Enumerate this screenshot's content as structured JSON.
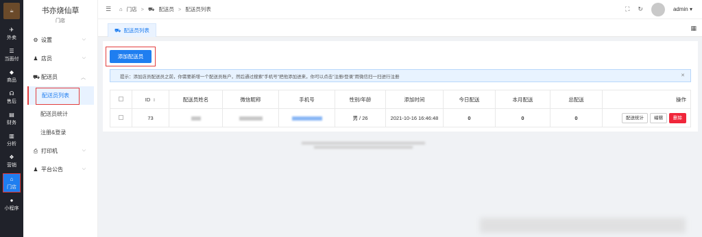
{
  "rail": {
    "items": [
      {
        "label": "外卖",
        "icon": "bike-icon",
        "glyph": "✈"
      },
      {
        "label": "当面付",
        "icon": "list-icon",
        "glyph": "☰"
      },
      {
        "label": "商品",
        "icon": "goods-icon",
        "glyph": "◆"
      },
      {
        "label": "售后",
        "icon": "headset-icon",
        "glyph": "☊"
      },
      {
        "label": "财务",
        "icon": "book-icon",
        "glyph": "▤"
      },
      {
        "label": "分析",
        "icon": "bar-chart-icon",
        "glyph": "▥"
      },
      {
        "label": "营销",
        "icon": "gift-icon",
        "glyph": "❖"
      },
      {
        "label": "门店",
        "icon": "store-icon",
        "glyph": "⌂"
      },
      {
        "label": "小程序",
        "icon": "chat-icon",
        "glyph": "●"
      }
    ]
  },
  "brand": {
    "name": "书亦烧仙草",
    "sub": "门店"
  },
  "menu": {
    "settings": "设置",
    "shop": "店员",
    "courier": "配送员",
    "courier_list": "配送员列表",
    "courier_stats": "配送员统计",
    "register": "注册&登录",
    "printer": "打印机",
    "notice": "平台公告"
  },
  "header": {
    "crumb1": "门店",
    "crumb2": "配送员",
    "crumb3": "配送员列表",
    "user": "admin"
  },
  "tab": {
    "label": "配送员列表"
  },
  "main": {
    "add_button": "添加配送员",
    "tip": "提示：添加店员配送员之前，你需要新增一个配送员账户，然后通过搜索\"手机号\"把他添加进来，你可以点击\"注册/登录\"用微信扫一扫进行注册"
  },
  "table": {
    "headers": [
      "ID",
      "配送员姓名",
      "微信昵称",
      "手机号",
      "性别/年龄",
      "添加时间",
      "今日配送",
      "本月配送",
      "总配送",
      "操作"
    ],
    "row": {
      "id": "73",
      "gender_age": "男 / 26",
      "time": "2021-10-16 16:46:48",
      "today": "0",
      "month": "0",
      "total": "0",
      "btn_stats": "配送统计",
      "btn_edit": "编辑",
      "btn_delete": "删除"
    }
  }
}
